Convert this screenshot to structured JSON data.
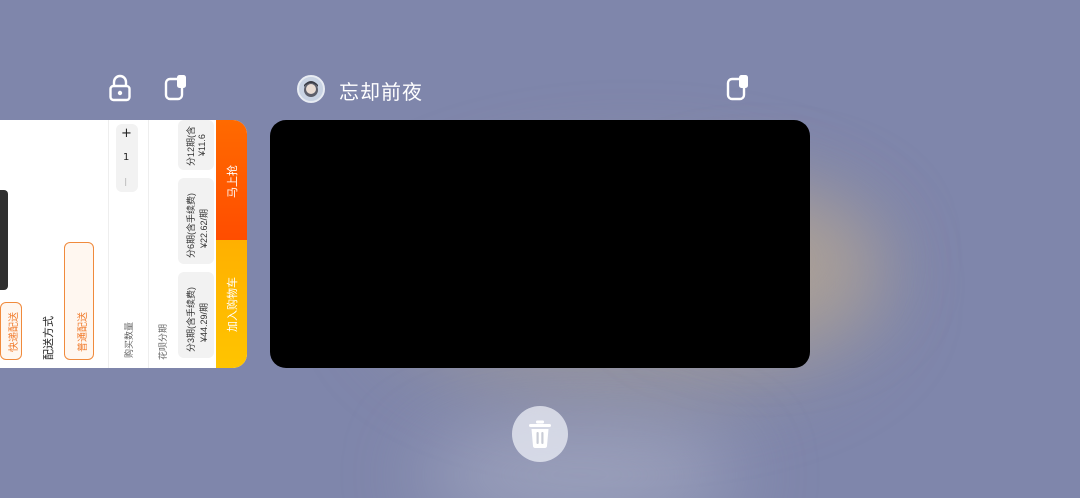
{
  "recents": {
    "foreground_app": {
      "title": "忘却前夜"
    },
    "left_card": {
      "delivery_label": "配送方式",
      "express_option": "快递配送",
      "standard_option": "普通配送",
      "quantity_label": "购买数量",
      "quantity_value": "1",
      "minus": "—",
      "plus": "+",
      "installment_label": "花呗分期",
      "installments": [
        {
          "label": "分3期(含手续费)",
          "price": "¥44.29/期"
        },
        {
          "label": "分6期(含手续费)",
          "price": "¥22.62/期"
        },
        {
          "label": "分12期(含",
          "price": "¥11.6"
        }
      ],
      "buy_now": "马上抢",
      "add_to_cart": "加入购物车"
    }
  },
  "colors": {
    "background": "#7f86ab",
    "accent_orange": "#ff5a00",
    "accent_yellow": "#ffbb00"
  }
}
